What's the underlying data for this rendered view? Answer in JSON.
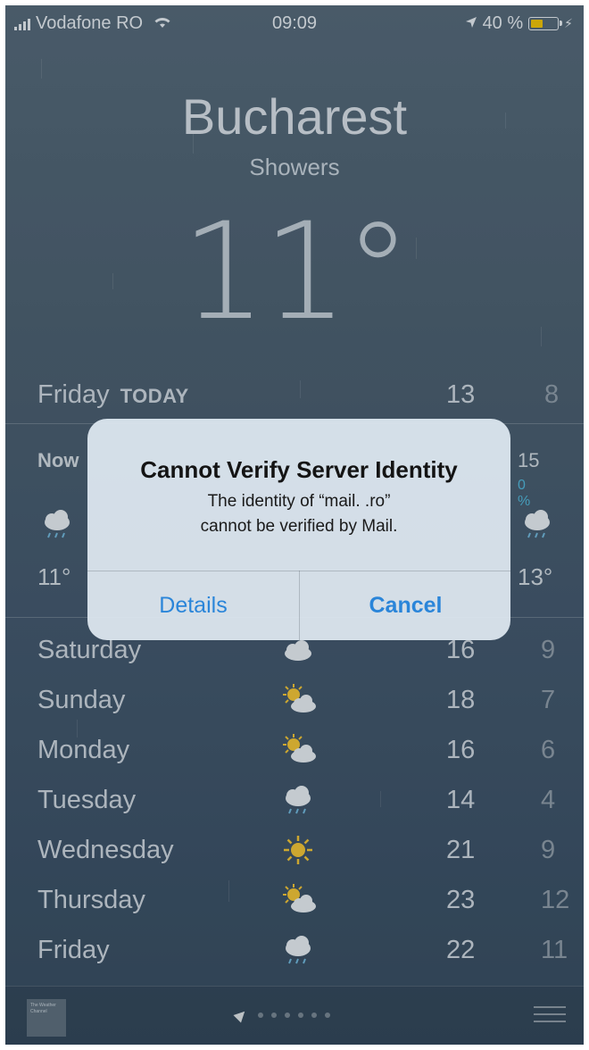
{
  "status_bar": {
    "carrier": "Vodafone RO",
    "time": "09:09",
    "battery": "40 %",
    "battery_level": 0.4,
    "icons": [
      "signal-icon",
      "wifi-icon",
      "location-arrow-icon",
      "battery-icon",
      "charging-bolt-icon"
    ]
  },
  "weather": {
    "city": "Bucharest",
    "condition": "Showers",
    "temperature": "11°",
    "today": {
      "day": "Friday",
      "tag": "TODAY",
      "high": "13",
      "low": "8"
    },
    "hourly": [
      {
        "label": "Now",
        "precip": "",
        "icon": "rain-cloud-icon",
        "temp": "11°"
      },
      {
        "label": "15",
        "precip": "0 %",
        "icon": "rain-cloud-icon",
        "temp": "13°"
      }
    ],
    "forecast": [
      {
        "day": "Saturday",
        "icon": "cloud-icon",
        "high": "16",
        "low": "9"
      },
      {
        "day": "Sunday",
        "icon": "partly-cloudy-icon",
        "high": "18",
        "low": "7"
      },
      {
        "day": "Monday",
        "icon": "partly-cloudy-icon",
        "high": "16",
        "low": "6"
      },
      {
        "day": "Tuesday",
        "icon": "rain-cloud-icon",
        "high": "14",
        "low": "4"
      },
      {
        "day": "Wednesday",
        "icon": "sun-icon",
        "high": "21",
        "low": "9"
      },
      {
        "day": "Thursday",
        "icon": "partly-cloudy-icon",
        "high": "23",
        "low": "12"
      },
      {
        "day": "Friday",
        "icon": "rain-cloud-icon",
        "high": "22",
        "low": "11"
      }
    ]
  },
  "bottom_bar": {
    "logo_text": "The Weather Channel",
    "page_dots": 6
  },
  "alert": {
    "title": "Cannot Verify Server Identity",
    "message_line1": "The identity of “mail.                        .ro”",
    "message_line2": "cannot be verified by Mail.",
    "details_label": "Details",
    "cancel_label": "Cancel"
  },
  "colors": {
    "alert_button": "#2a85d9",
    "precip_text": "#4fb6d8",
    "battery_fill": "#f2c200"
  }
}
